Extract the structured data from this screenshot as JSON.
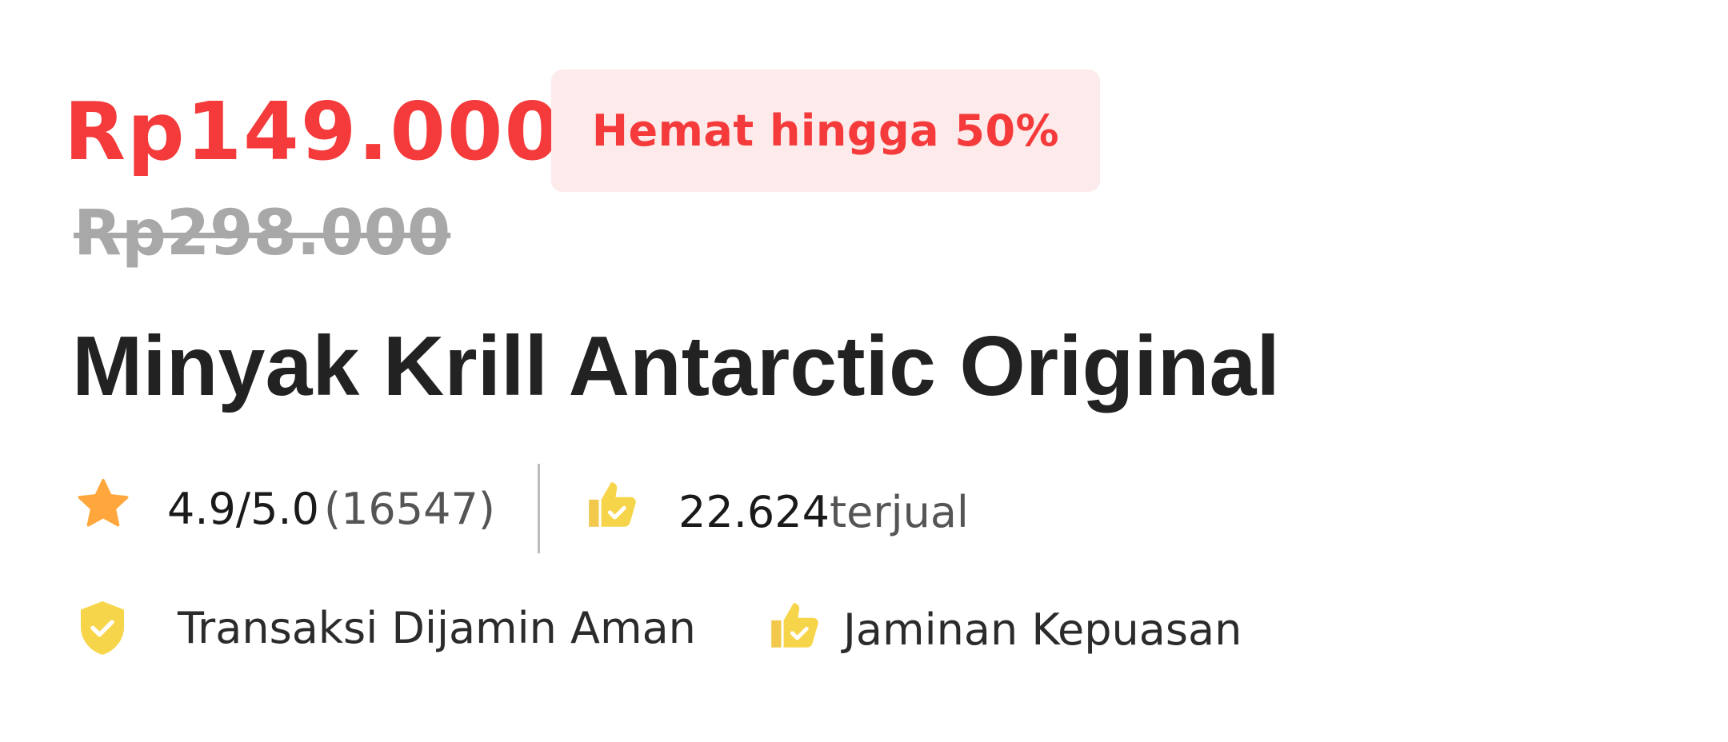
{
  "price": {
    "current": "Rp149.000",
    "discount_badge": "Hemat hingga 50%",
    "original": "Rp298.000"
  },
  "product": {
    "title": "Minyak Krill Antarctic Original"
  },
  "stats": {
    "rating": "4.9/5.0",
    "review_count": "(16547)",
    "sold_count": "22.624",
    "sold_label": "terjual"
  },
  "assurances": [
    {
      "label": "Transaksi Dijamin Aman",
      "icon": "shield-check-icon"
    },
    {
      "label": "Jaminan Kepuasan",
      "icon": "thumbs-up-icon"
    }
  ],
  "colors": {
    "accent": "#f43a3a",
    "badge_bg": "#fdeaea",
    "strikethrough": "#a8a8a8",
    "star": "#ffa73c",
    "icon_yellow": "#f7d54a"
  }
}
